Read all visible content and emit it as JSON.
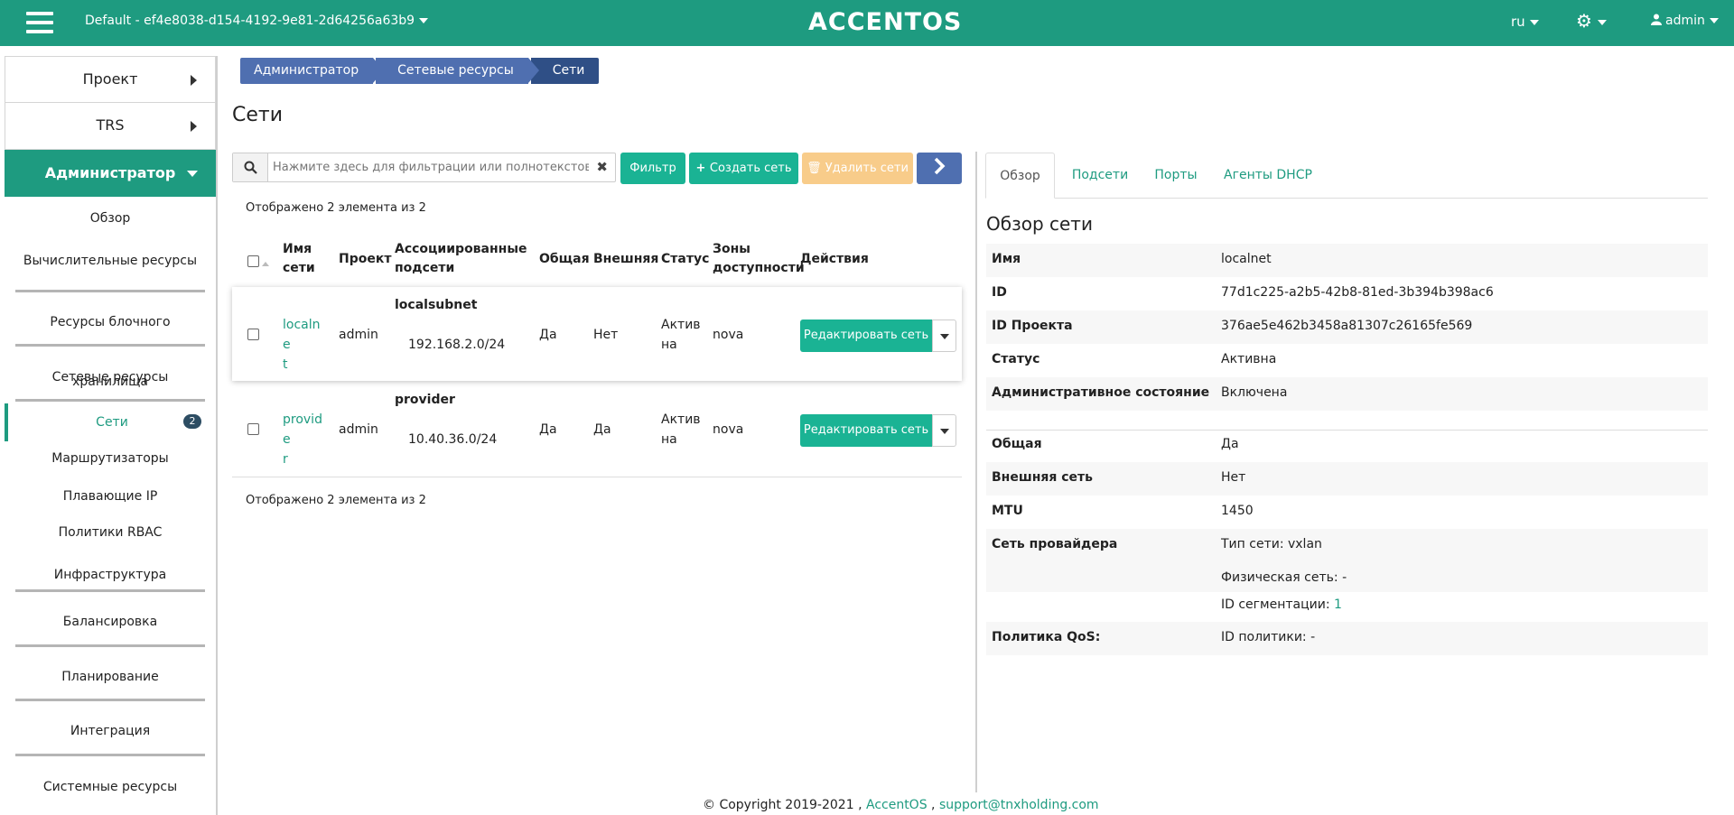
{
  "header": {
    "project": "Default - ef4e8038-d154-4192-9e81-2d64256a63b9",
    "logo": "ACCENTOS",
    "lang": "ru",
    "user": "admin"
  },
  "sidebar": {
    "project": "Проект",
    "trs": "TRS",
    "admin": "Администратор",
    "items": [
      "Обзор",
      "Вычислительные ресурсы",
      "Ресурсы блочного хранилища",
      "Сетевые ресурсы",
      "Сети",
      "Маршрутизаторы",
      "Плавающие IP",
      "Политики RBAC",
      "Инфраструктура",
      "Балансировка",
      "Планирование",
      "Интеграция",
      "Системные ресурсы"
    ],
    "networks_badge": "2"
  },
  "breadcrumb": [
    "Администратор",
    "Сетевые ресурсы",
    "Сети"
  ],
  "page_title": "Сети",
  "toolbar": {
    "search_placeholder": "Нажмите здесь для фильтрации или полнотекстового ...",
    "filter": "Фильтр",
    "create": "Создать сеть",
    "delete": "Удалить сети"
  },
  "table": {
    "counter": "Отображено 2 элемента из 2",
    "headers": {
      "name": [
        "Имя",
        "сети"
      ],
      "project": "Проект",
      "subnets": [
        "Ассоциированные",
        "подсети"
      ],
      "shared": "Общая",
      "external": "Внешняя",
      "status": "Статус",
      "zones": [
        "Зоны",
        "доступности"
      ],
      "actions": "Действия"
    },
    "rows": [
      {
        "name_lines": [
          "localne",
          "t"
        ],
        "project": "admin",
        "subnet_name": "localsubnet",
        "subnet_cidr": "192.168.2.0/24",
        "shared": "Да",
        "external": "Нет",
        "status_lines": [
          "Актив",
          "на"
        ],
        "zone": "nova",
        "action": "Редактировать сеть"
      },
      {
        "name_lines": [
          "provide",
          "r"
        ],
        "project": "admin",
        "subnet_name": "provider",
        "subnet_cidr": "10.40.36.0/24",
        "shared": "Да",
        "external": "Да",
        "status_lines": [
          "Актив",
          "на"
        ],
        "zone": "nova",
        "action": "Редактировать сеть"
      }
    ]
  },
  "detail": {
    "tabs": [
      "Обзор",
      "Подсети",
      "Порты",
      "Агенты DHCP"
    ],
    "title": "Обзор сети",
    "rows": [
      {
        "k": "Имя",
        "v": "localnet"
      },
      {
        "k": "ID",
        "v": "77d1c225-a2b5-42b8-81ed-3b394b398ac6"
      },
      {
        "k": "ID Проекта",
        "v": "376ae5e462b3458a81307c26165fe569"
      },
      {
        "k": "Статус",
        "v": "Активна"
      },
      {
        "k": "Административное состояние",
        "v": "Включена"
      },
      {
        "k": "Общая",
        "v": "Да"
      },
      {
        "k": "Внешняя сеть",
        "v": "Нет"
      },
      {
        "k": "MTU",
        "v": "1450"
      },
      {
        "k": "Сеть провайдера",
        "v": "Тип сети: vxlan"
      },
      {
        "k": "",
        "v": "Физическая сеть: -"
      },
      {
        "k": "",
        "v_label": "ID сегментации: ",
        "v_link": "1"
      },
      {
        "k": "Политика QoS:",
        "v": "ID политики: -"
      }
    ]
  },
  "footer": {
    "copyright": "© Copyright 2019-2021 ,",
    "accentos": "AccentOS",
    "sep": ",",
    "email": "support@tnxholding.com"
  }
}
